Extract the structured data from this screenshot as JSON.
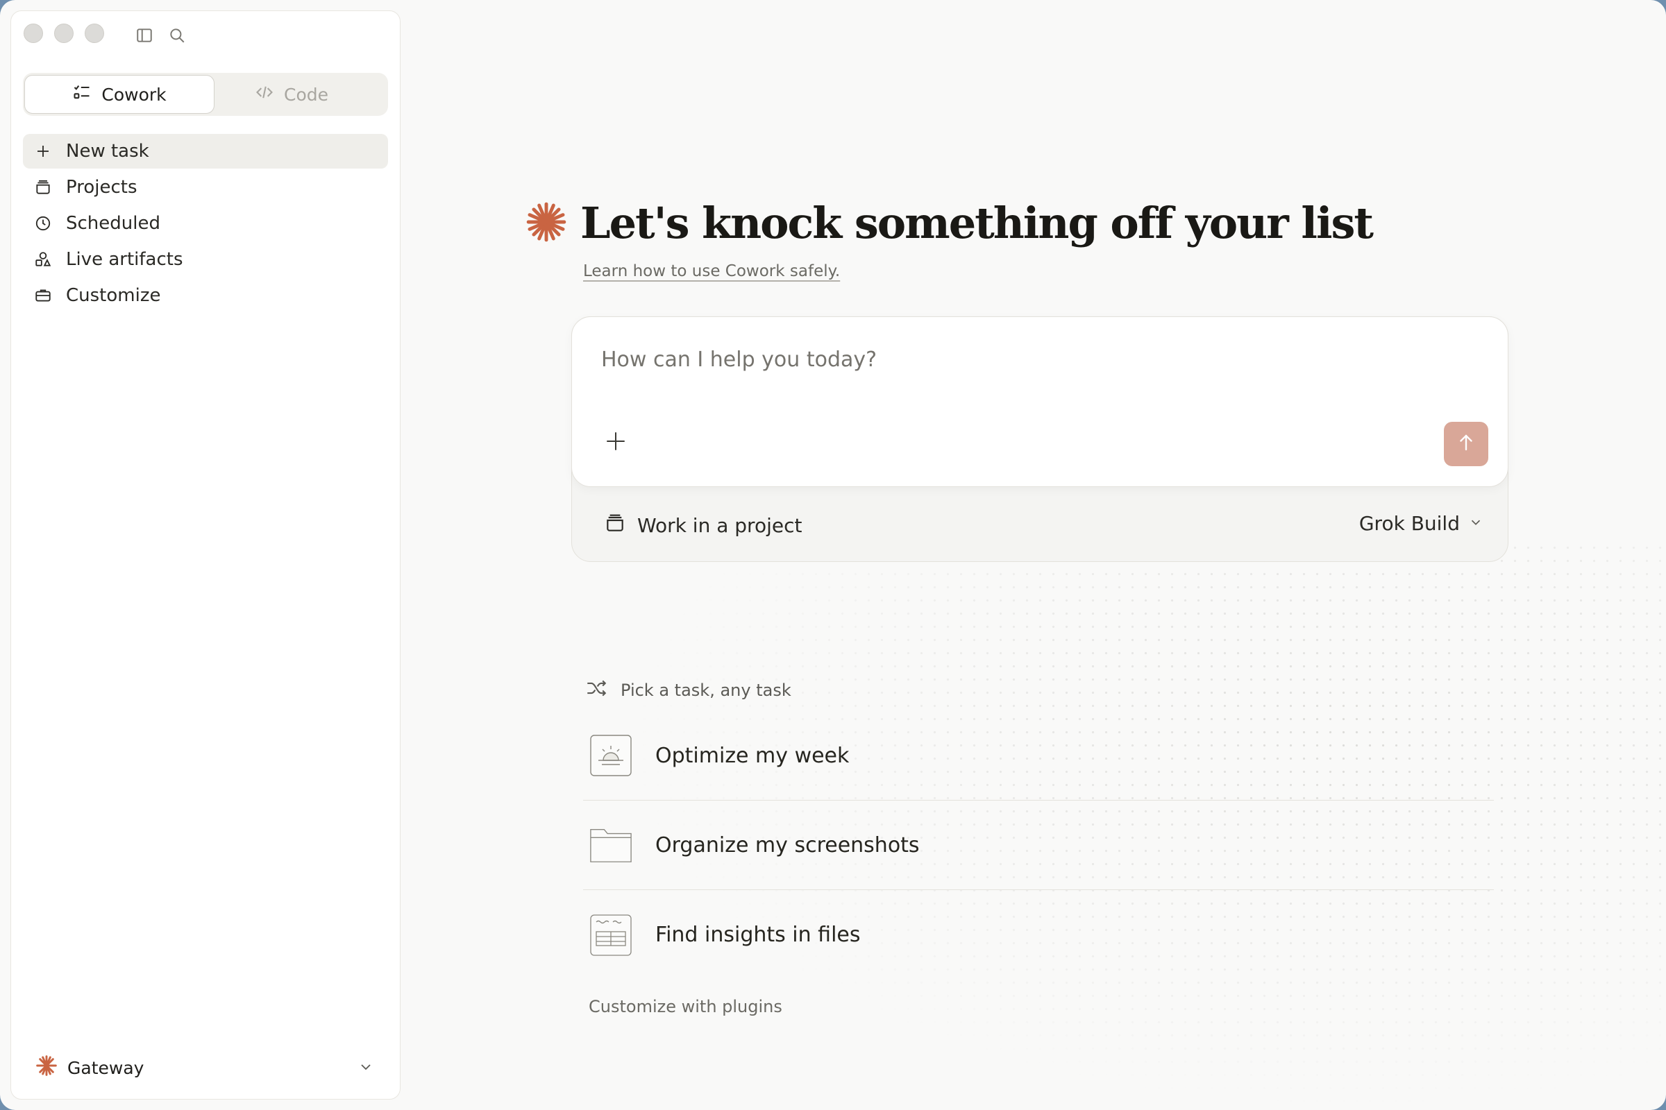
{
  "sidebar": {
    "mode_switch": {
      "cowork_label": "Cowork",
      "code_label": "Code"
    },
    "items": [
      {
        "label": "New task",
        "icon": "plus-icon"
      },
      {
        "label": "Projects",
        "icon": "projects-icon"
      },
      {
        "label": "Scheduled",
        "icon": "clock-icon"
      },
      {
        "label": "Live artifacts",
        "icon": "shapes-icon"
      },
      {
        "label": "Customize",
        "icon": "briefcase-icon"
      }
    ],
    "account": {
      "name": "Gateway"
    }
  },
  "main": {
    "headline": "Let's knock something off your list",
    "learn_link": "Learn how to use Cowork safely.",
    "composer": {
      "placeholder": "How can I help you today?",
      "project_label": "Work in a project",
      "model_label": "Grok Build"
    },
    "pick_label": "Pick a task, any task",
    "tasks": [
      {
        "label": "Optimize my week",
        "icon": "sunrise-icon"
      },
      {
        "label": "Organize my screenshots",
        "icon": "folder-icon"
      },
      {
        "label": "Find insights in files",
        "icon": "spreadsheet-icon"
      }
    ],
    "plugins_label": "Customize with plugins"
  },
  "colors": {
    "accent": "#c96442",
    "send_button": "#d9a798",
    "background": "#f9f9f8"
  }
}
